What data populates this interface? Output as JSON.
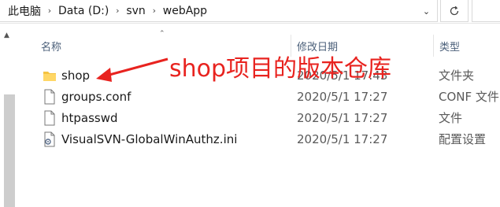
{
  "address": {
    "breadcrumbs": [
      "此电脑",
      "Data (D:)",
      "svn",
      "webApp"
    ],
    "separator_icon": "chevron-right-icon",
    "dropdown_icon": "chevron-down-icon",
    "refresh_icon": "refresh-icon"
  },
  "columns": {
    "name": "名称",
    "date": "修改日期",
    "type": "类型"
  },
  "files": [
    {
      "name": "shop",
      "date": "2020/5/1 17:43",
      "type": "文件夹",
      "icon": "folder-icon"
    },
    {
      "name": "groups.conf",
      "date": "2020/5/1 17:27",
      "type": "CONF 文件",
      "icon": "file-icon"
    },
    {
      "name": "htpasswd",
      "date": "2020/5/1 17:27",
      "type": "文件",
      "icon": "file-icon"
    },
    {
      "name": "VisualSVN-GlobalWinAuthz.ini",
      "date": "2020/5/1 17:27",
      "type": "配置设置",
      "icon": "settings-file-icon"
    }
  ],
  "annotation": {
    "text": "shop项目的版本仓库",
    "color": "#e8231f"
  },
  "colors": {
    "folder": "#f5c342",
    "header_text": "#4c607a"
  }
}
